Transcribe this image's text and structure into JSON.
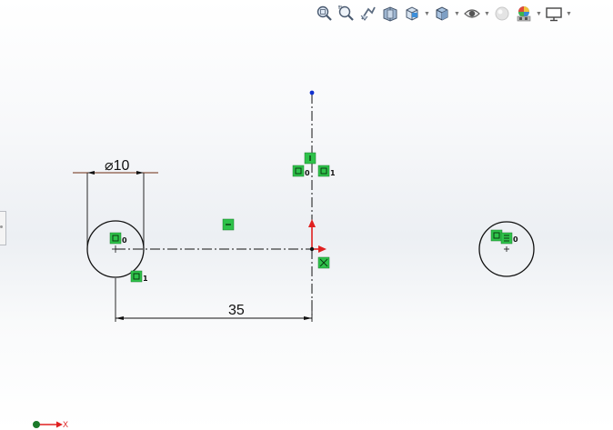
{
  "toolbar": {
    "icons": [
      "zoom-to-fit-icon",
      "zoom-to-area-icon",
      "previous-view-icon",
      "section-view-icon",
      "view-orientation-icon",
      "display-style-icon",
      "hide-show-items-icon",
      "edit-appearance-icon",
      "apply-scene-icon",
      "view-settings-icon"
    ]
  },
  "sketch": {
    "diameter_dimension": "⌀10",
    "linear_dimension": "35",
    "relation_labels": {
      "circle_left_coincident": "0",
      "circle_left_tangent": "1",
      "centerline_top_a": "0",
      "centerline_top_b": "1",
      "circle_right": "0"
    }
  },
  "triad": {
    "x_label": "X"
  },
  "colors": {
    "relation_green": "#2ec24a",
    "axis_red": "#e02020",
    "point_blue": "#1030d0",
    "sketch_black": "#111111"
  }
}
